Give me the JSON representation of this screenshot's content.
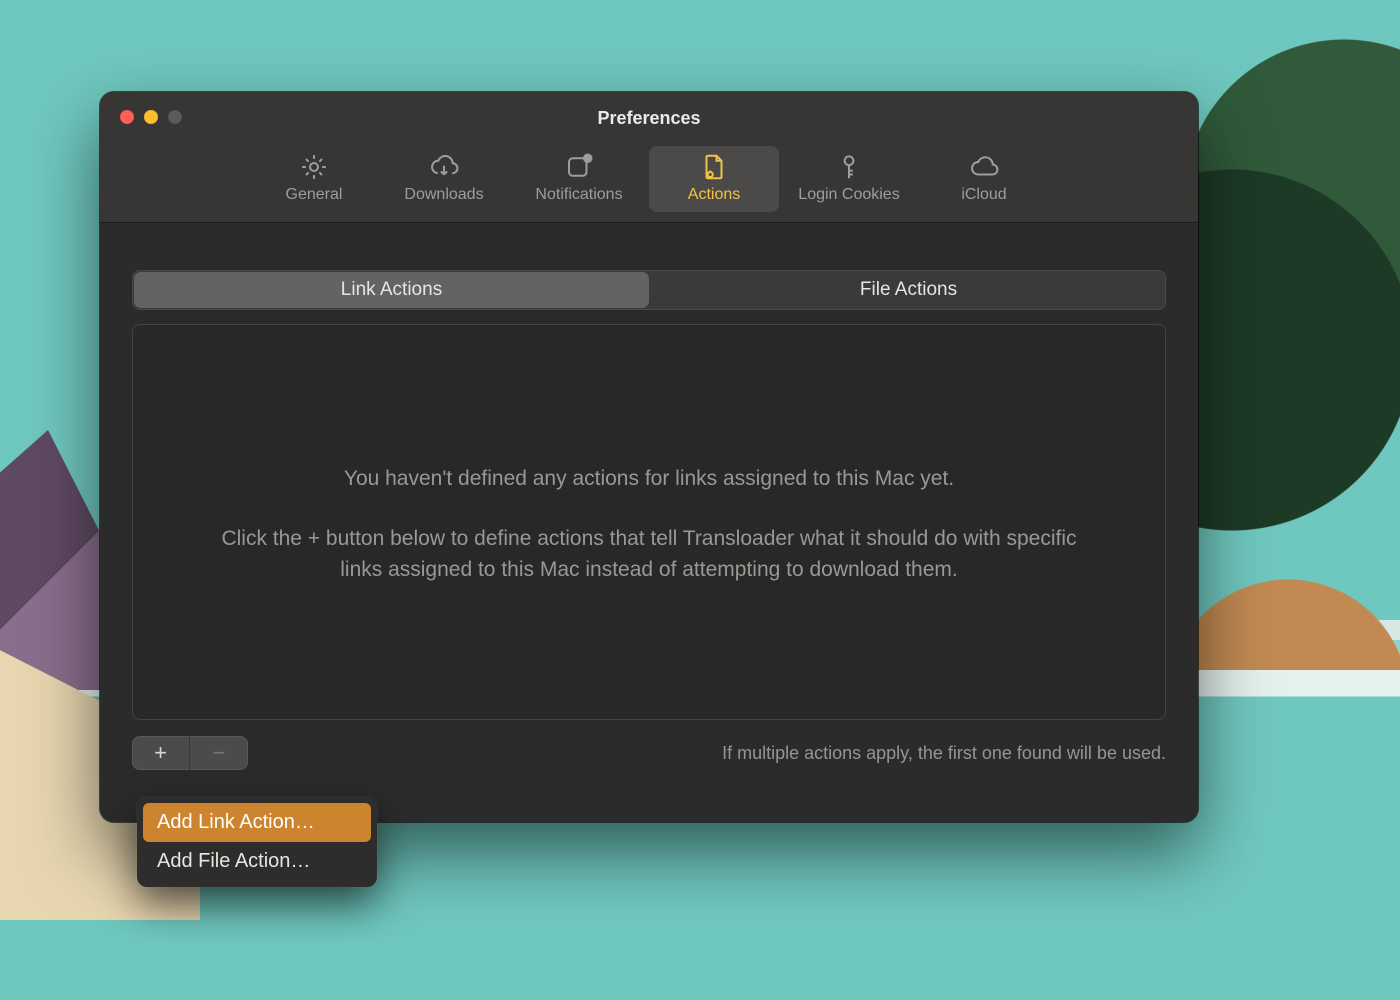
{
  "window": {
    "title": "Preferences"
  },
  "toolbar": {
    "tabs": [
      {
        "label": "General"
      },
      {
        "label": "Downloads"
      },
      {
        "label": "Notifications"
      },
      {
        "label": "Actions"
      },
      {
        "label": "Login Cookies"
      },
      {
        "label": "iCloud"
      }
    ],
    "selected_index": 3
  },
  "segmented": {
    "items": [
      "Link Actions",
      "File Actions"
    ],
    "active_index": 0
  },
  "empty_state": {
    "line1": "You haven't defined any actions for links assigned to this Mac yet.",
    "line2": "Click the + button below to define actions that tell Transloader what it should do with specific links assigned to this Mac instead of attempting to download them."
  },
  "footer": {
    "note": "If multiple actions apply, the first one found will be used.",
    "add_symbol": "+",
    "remove_symbol": "−"
  },
  "add_menu": {
    "items": [
      "Add Link Action…",
      "Add File Action…"
    ],
    "highlighted_index": 0
  },
  "colors": {
    "accent": "#f0c349",
    "menu_highlight": "#cc842e"
  }
}
